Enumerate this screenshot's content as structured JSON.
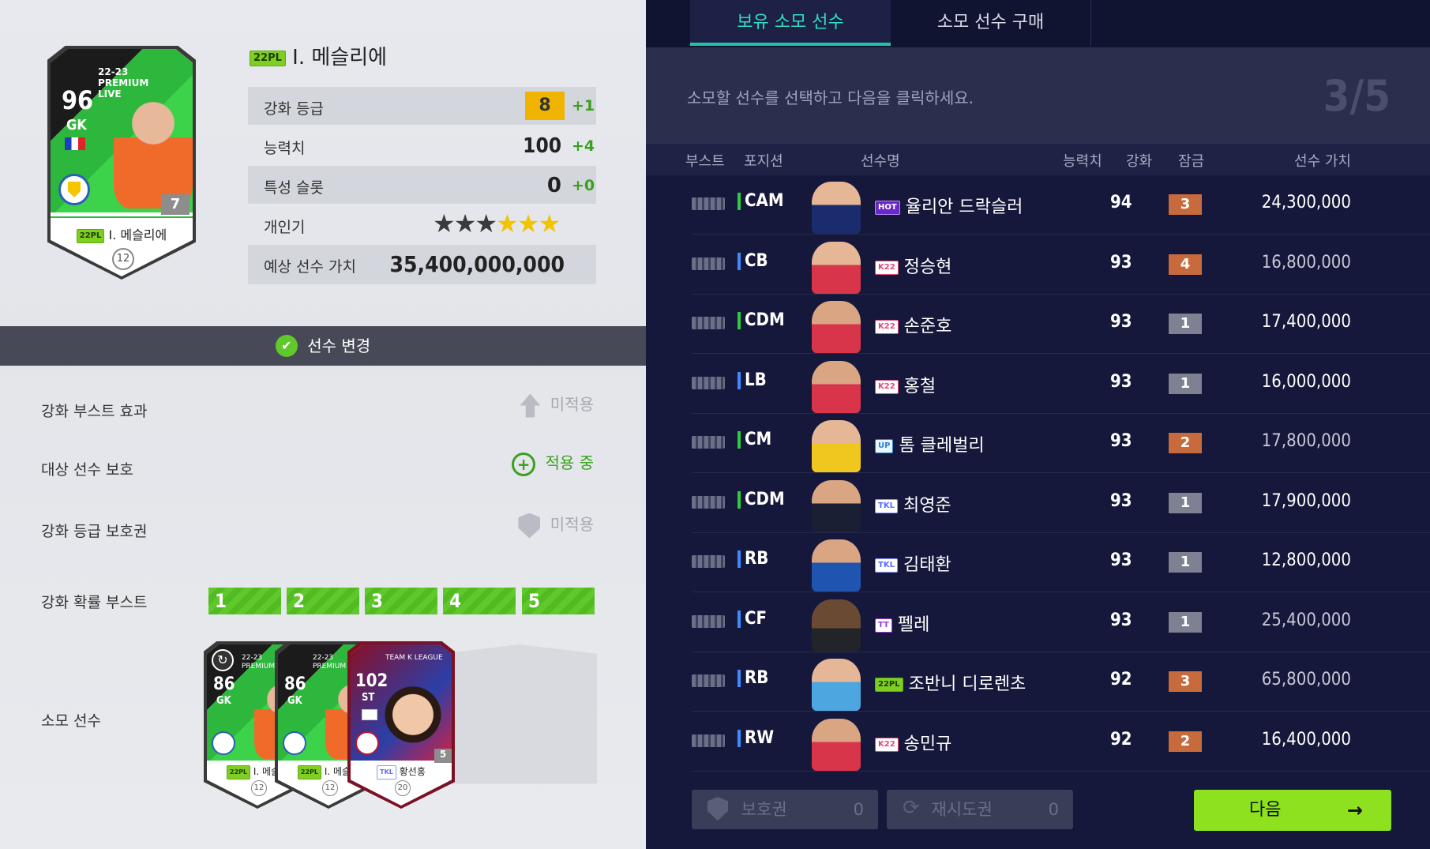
{
  "player": {
    "name": "I. 메슬리에",
    "season_badge": "22PL",
    "card": {
      "ovr": "96",
      "position": "GK",
      "season_text": "22-23 PREMIUM LIVE",
      "level": "7",
      "pay": "12",
      "name": "I. 메슬리에"
    }
  },
  "stats": [
    {
      "label": "강화 등급",
      "value": "8",
      "delta": "+1"
    },
    {
      "label": "능력치",
      "value": "100",
      "delta": "+4"
    },
    {
      "label": "특성 슬롯",
      "value": "0",
      "delta": "+0"
    },
    {
      "label": "개인기",
      "stars_dark": 3,
      "stars_gold": 3
    },
    {
      "label": "예상 선수 가치",
      "value": "35,400,000,000"
    }
  ],
  "change_bar": {
    "label": "선수 변경"
  },
  "options": [
    {
      "label": "강화 부스트 효과",
      "value": "미적용",
      "icon": "up-arrow-icon",
      "active": false
    },
    {
      "label": "대상 선수 보호",
      "value": "적용 중",
      "icon": "protect-plus-icon",
      "active": true
    },
    {
      "label": "강화 등급 보호권",
      "value": "미적용",
      "icon": "shield-icon",
      "active": false
    }
  ],
  "boost": {
    "label": "강화 확률 부스트",
    "segments": [
      "1",
      "2",
      "3",
      "4",
      "5"
    ]
  },
  "consume": {
    "label": "소모 선수",
    "cards": [
      {
        "ovr": "86",
        "position": "GK",
        "season_text": "22-23 PREMIUM",
        "badge": "22PL",
        "name": "I. 메슬리",
        "pay": "12"
      },
      {
        "ovr": "86",
        "position": "GK",
        "season_text": "22-23 PREMIUM",
        "badge": "22PL",
        "name": "I. 메슬리",
        "pay": "12"
      },
      {
        "ovr": "102",
        "position": "ST",
        "season_text": "TEAM K LEAGUE",
        "badge": "TKL",
        "name": "황선홍",
        "pay": "20",
        "level": "5"
      }
    ]
  },
  "tabs": [
    {
      "label": "보유 소모 선수",
      "active": true
    },
    {
      "label": "소모 선수 구매",
      "active": false
    }
  ],
  "instruction": {
    "text": "소모할 선수를 선택하고 다음을 클릭하세요.",
    "count": "3/5"
  },
  "table": {
    "headers": {
      "boost": "부스트",
      "position": "포지션",
      "name": "선수명",
      "ovr": "능력치",
      "level": "강화",
      "lock": "잠금",
      "value": "선수 가치"
    },
    "rows": [
      {
        "pos": "CAM",
        "badge": "HOT",
        "badge_class": "hot",
        "name": "율리안 드락슬러",
        "ovr": "94",
        "level": "3",
        "value": "24,300,000",
        "bright": true
      },
      {
        "pos": "CB",
        "badge": "K22",
        "badge_class": "k22",
        "name": "정승현",
        "ovr": "93",
        "level": "4",
        "value": "16,800,000",
        "bright": false
      },
      {
        "pos": "CDM",
        "badge": "K22",
        "badge_class": "k22",
        "name": "손준호",
        "ovr": "93",
        "level": "1",
        "value": "17,400,000",
        "bright": true
      },
      {
        "pos": "LB",
        "badge": "K22",
        "badge_class": "k22",
        "name": "홍철",
        "ovr": "93",
        "level": "1",
        "value": "16,000,000",
        "bright": true
      },
      {
        "pos": "CM",
        "badge": "UP",
        "badge_class": "up",
        "name": "톰 클레벌리",
        "ovr": "93",
        "level": "2",
        "value": "17,800,000",
        "bright": false
      },
      {
        "pos": "CDM",
        "badge": "TKL",
        "badge_class": "tkl",
        "name": "최영준",
        "ovr": "93",
        "level": "1",
        "value": "17,900,000",
        "bright": true
      },
      {
        "pos": "RB",
        "badge": "TKL",
        "badge_class": "tkl",
        "name": "김태환",
        "ovr": "93",
        "level": "1",
        "value": "12,800,000",
        "bright": true
      },
      {
        "pos": "CF",
        "badge": "TT",
        "badge_class": "tt",
        "name": "펠레",
        "ovr": "93",
        "level": "1",
        "value": "25,400,000",
        "bright": false
      },
      {
        "pos": "RB",
        "badge": "22PL",
        "badge_class": "green-badge",
        "name": "조반니 디로렌초",
        "ovr": "92",
        "level": "3",
        "value": "65,800,000",
        "bright": false
      },
      {
        "pos": "RW",
        "badge": "K22",
        "badge_class": "k22",
        "name": "송민규",
        "ovr": "92",
        "level": "2",
        "value": "16,400,000",
        "bright": true
      }
    ]
  },
  "footer": {
    "protect": {
      "label": "보호권",
      "count": "0"
    },
    "retry": {
      "label": "재시도권",
      "count": "0"
    },
    "next": {
      "label": "다음"
    }
  },
  "colors": {
    "accent_green": "#8ee11e",
    "tab_underline": "#1fc3a8",
    "panel_dark": "#15183a"
  }
}
